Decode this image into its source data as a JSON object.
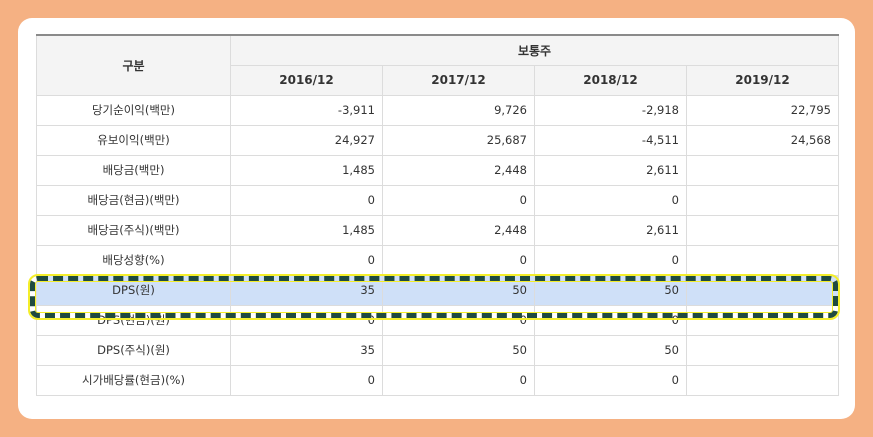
{
  "table": {
    "header_label": "구분",
    "group_header": "보통주",
    "years": [
      "2016/12",
      "2017/12",
      "2018/12",
      "2019/12"
    ],
    "rows": [
      {
        "label": "당기순이익(백만)",
        "values": [
          "-3,911",
          "9,726",
          "-2,918",
          "22,795"
        ]
      },
      {
        "label": "유보이익(백만)",
        "values": [
          "24,927",
          "25,687",
          "-4,511",
          "24,568"
        ]
      },
      {
        "label": "배당금(백만)",
        "values": [
          "1,485",
          "2,448",
          "2,611",
          ""
        ]
      },
      {
        "label": "배당금(현금)(백만)",
        "values": [
          "0",
          "0",
          "0",
          ""
        ]
      },
      {
        "label": "배당금(주식)(백만)",
        "values": [
          "1,485",
          "2,448",
          "2,611",
          ""
        ]
      },
      {
        "label": "배당성향(%)",
        "values": [
          "0",
          "0",
          "0",
          ""
        ]
      },
      {
        "label": "DPS(원)",
        "values": [
          "35",
          "50",
          "50",
          ""
        ],
        "highlighted": true
      },
      {
        "label": "DPS(현금)(원)",
        "values": [
          "0",
          "0",
          "0",
          ""
        ]
      },
      {
        "label": "DPS(주식)(원)",
        "values": [
          "35",
          "50",
          "50",
          ""
        ]
      },
      {
        "label": "시가배당률(현금)(%)",
        "values": [
          "0",
          "0",
          "0",
          ""
        ]
      }
    ]
  },
  "colors": {
    "frame": "#f5b183",
    "highlight_row": "#cfe0f8",
    "highlight_border_dash": "#1f4a40",
    "highlight_border_outline": "#f4ee2a"
  }
}
